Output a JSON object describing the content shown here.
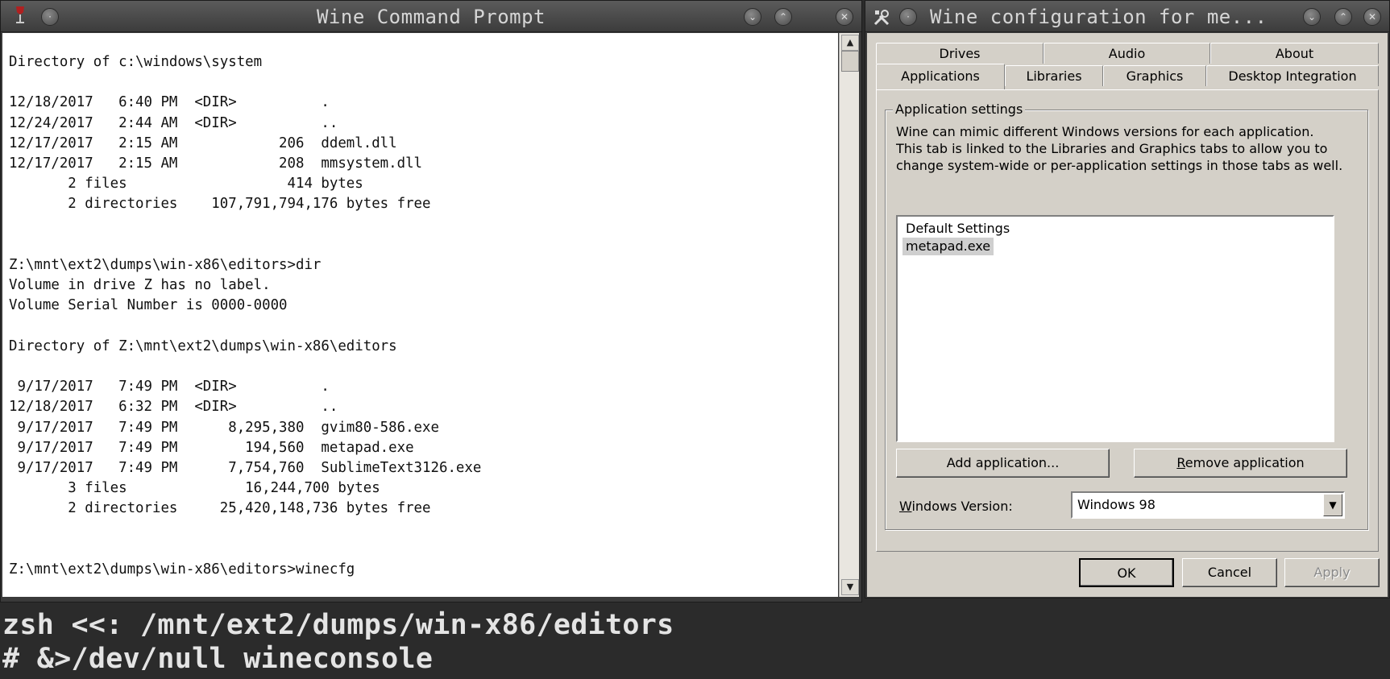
{
  "console": {
    "title": "Wine Command Prompt",
    "lines": [
      "Directory of c:\\windows\\system",
      "",
      "12/18/2017   6:40 PM  <DIR>          .",
      "12/24/2017   2:44 AM  <DIR>          ..",
      "12/17/2017   2:15 AM            206  ddeml.dll",
      "12/17/2017   2:15 AM            208  mmsystem.dll",
      "       2 files                   414 bytes",
      "       2 directories    107,791,794,176 bytes free",
      "",
      "",
      "Z:\\mnt\\ext2\\dumps\\win-x86\\editors>dir",
      "Volume in drive Z has no label.",
      "Volume Serial Number is 0000-0000",
      "",
      "Directory of Z:\\mnt\\ext2\\dumps\\win-x86\\editors",
      "",
      " 9/17/2017   7:49 PM  <DIR>          .",
      "12/18/2017   6:32 PM  <DIR>          ..",
      " 9/17/2017   7:49 PM      8,295,380  gvim80-586.exe",
      " 9/17/2017   7:49 PM        194,560  metapad.exe",
      " 9/17/2017   7:49 PM      7,754,760  SublimeText3126.exe",
      "       3 files              16,244,700 bytes",
      "       2 directories     25,420,148,736 bytes free",
      "",
      "",
      "Z:\\mnt\\ext2\\dumps\\win-x86\\editors>winecfg"
    ]
  },
  "winecfg": {
    "title": "Wine configuration for me...",
    "tabs_row1": [
      "Drives",
      "Audio",
      "About"
    ],
    "tabs_row2": [
      "Applications",
      "Libraries",
      "Graphics",
      "Desktop Integration"
    ],
    "active_tab": "Applications",
    "group_title": "Application settings",
    "description": "Wine can mimic different Windows versions for each application.\nThis tab is linked to the Libraries and Graphics tabs to allow you to\nchange system-wide or per-application settings in those tabs as well.",
    "applications": [
      "Default Settings",
      "metapad.exe"
    ],
    "selected_application": "metapad.exe",
    "add_button": "Add application...",
    "remove_button": "Remove application",
    "windows_version_label": "Windows Version:",
    "windows_version_value": "Windows 98",
    "ok_button": "OK",
    "cancel_button": "Cancel",
    "apply_button": "Apply"
  },
  "zsh": {
    "line1": "zsh <<: /mnt/ext2/dumps/win-x86/editors",
    "line2": "# &>/dev/null wineconsole"
  },
  "icons": {
    "console_app_icon": "wine-glass-icon",
    "winecfg_app_icon": "tools-icon"
  }
}
